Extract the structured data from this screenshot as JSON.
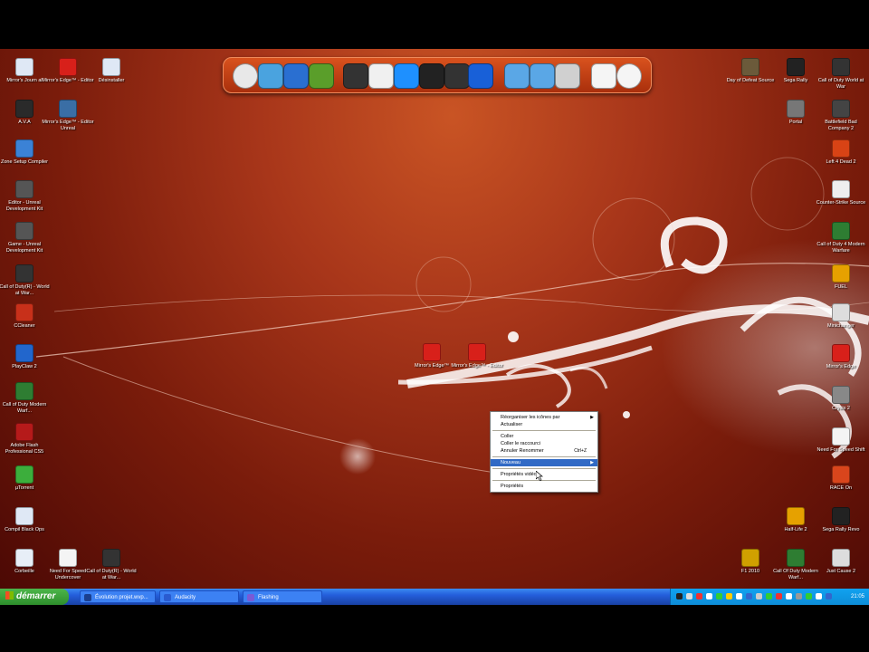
{
  "desktop_icons": [
    {
      "label": "Mirror's Journ al",
      "icon": "document-icon"
    },
    {
      "label": "Mirror's Edge™ - Editor",
      "icon": "mirrors-edge-icon"
    },
    {
      "label": "Désinstaller",
      "icon": "document-icon"
    },
    {
      "label": "A.V.A",
      "icon": "ava-icon"
    },
    {
      "label": "Mirror's Edge™ - Editor Unreal",
      "icon": "editor-icon"
    },
    {
      "label": "Zone Setup Compiler",
      "icon": "compiler-icon"
    },
    {
      "label": "Editor - Unreal Development Kit",
      "icon": "unreal-icon"
    },
    {
      "label": "Game - Unreal Development Kit",
      "icon": "unreal-icon"
    },
    {
      "label": "Call of Duty(R) - World at War...",
      "icon": "cod-icon"
    },
    {
      "label": "CCleaner",
      "icon": "ccleaner-icon"
    },
    {
      "label": "PlayClaw 2",
      "icon": "playclaw-icon"
    },
    {
      "label": "Call of Duty Modern Warf...",
      "icon": "cod-mw-icon"
    },
    {
      "label": "Adobe Flash Professional CS5",
      "icon": "flash-icon"
    },
    {
      "label": "µTorrent",
      "icon": "utorrent-icon"
    },
    {
      "label": "Compil Black Ops",
      "icon": "document-icon"
    },
    {
      "label": "Corbeille",
      "icon": "recycle-bin-icon"
    },
    {
      "label": "Need For Speed Undercover",
      "icon": "nfs-icon"
    },
    {
      "label": "Call of Duty(R) - World at War...",
      "icon": "cod-icon"
    },
    {
      "label": "Day of Defeat Source",
      "icon": "dod-icon"
    },
    {
      "label": "Sega Rally",
      "icon": "rally-icon"
    },
    {
      "label": "Call of Duty World at War",
      "icon": "cod-icon"
    },
    {
      "label": "Portal",
      "icon": "portal-icon"
    },
    {
      "label": "Battlefield Bad Company 2",
      "icon": "bf-icon"
    },
    {
      "label": "Left 4 Dead 2",
      "icon": "l4d-icon"
    },
    {
      "label": "Counter-Strike Source",
      "icon": "cs-icon"
    },
    {
      "label": "Call of Duty 4 Modern Warfare",
      "icon": "cod-mw-icon"
    },
    {
      "label": "FUEL",
      "icon": "fuel-icon"
    },
    {
      "label": "Minichanger",
      "icon": "game-icon"
    },
    {
      "label": "Mirror's Edge",
      "icon": "mirrors-edge-icon"
    },
    {
      "label": "Crysis 2",
      "icon": "crysis-icon"
    },
    {
      "label": "Need For Speed Shift",
      "icon": "nfs-icon"
    },
    {
      "label": "RACE On",
      "icon": "race-icon"
    },
    {
      "label": "Half-Life 2",
      "icon": "half-life-icon"
    },
    {
      "label": "Sega Rally Revo",
      "icon": "rally-icon"
    },
    {
      "label": "F1 2010",
      "icon": "f1-icon"
    },
    {
      "label": "Call Of Duty Modern Warf...",
      "icon": "cod-mw-icon"
    },
    {
      "label": "Just Cause 2",
      "icon": "just-cause-icon"
    },
    {
      "label": "Mirror's Edge™",
      "icon": "mirrors-edge-icon"
    },
    {
      "label": "Mirror's Edge™ - Editor",
      "icon": "mirrors-edge-icon"
    }
  ],
  "dock_items": [
    "power-icon",
    "messenger-icon",
    "internet-explorer-icon",
    "xbox-icon",
    "steam-icon",
    "wii-icon",
    "itunes-icon",
    "monitor-icon",
    "camera-icon",
    "control-panel-icon",
    "folder-icon",
    "folder-icon",
    "application-icon",
    "document-icon",
    "clock-icon"
  ],
  "context_menu": {
    "arrange": "Réorganiser les icônes par",
    "refresh": "Actualiser",
    "paste": "Coller",
    "paste_shortcut": "Coller le raccourci",
    "undo_rename": "Annuler Renommer",
    "undo_shortcut": "Ctrl+Z",
    "new": "Nouveau",
    "display_props": "Propriétés vidéo",
    "properties": "Propriétés"
  },
  "taskbar": {
    "start_label": "démarrer",
    "tasks": [
      "Évolution projet.wvp...",
      "Audacity",
      "Flashing"
    ],
    "clock": "21:05"
  },
  "colors": {
    "accent": "#316ac5",
    "taskbar": "#245edb",
    "start": "#2e8f2c",
    "wallpaper": "#a8361a"
  }
}
